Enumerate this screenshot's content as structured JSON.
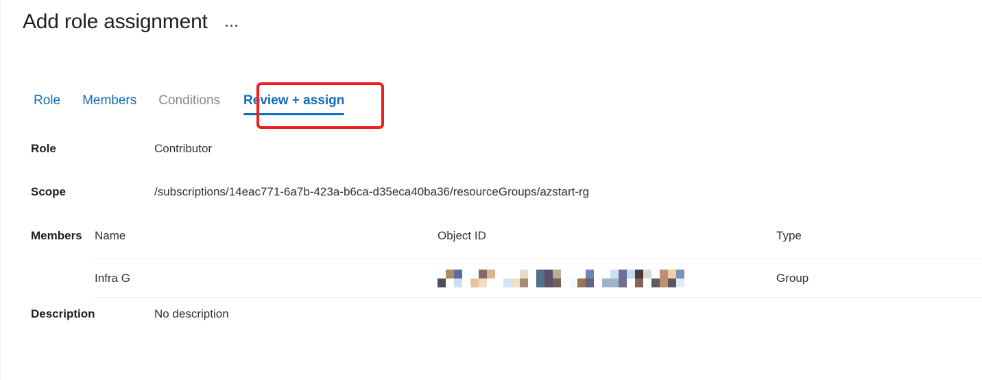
{
  "header": {
    "title": "Add role assignment",
    "more_actions_label": "More actions",
    "more_actions_icon": "ellipsis-icon"
  },
  "tabs": [
    {
      "label": "Role",
      "state": "link"
    },
    {
      "label": "Members",
      "state": "link"
    },
    {
      "label": "Conditions",
      "state": "disabled"
    },
    {
      "label": "Review + assign",
      "state": "active"
    }
  ],
  "highlight": {
    "target_tab": "Review + assign",
    "color": "#f01b1b"
  },
  "details": {
    "role": {
      "label": "Role",
      "value": "Contributor"
    },
    "scope": {
      "label": "Scope",
      "value": "/subscriptions/14eac771-6a7b-423a-b6ca-d35eca40ba36/resourceGroups/azstart-rg"
    },
    "members": {
      "label": "Members",
      "columns": [
        "Name",
        "Object ID",
        "Type"
      ],
      "rows": [
        {
          "name": "Infra G",
          "object_id": "",
          "object_id_redacted": true,
          "type": "Group"
        }
      ]
    },
    "description": {
      "label": "Description",
      "value": "No description"
    }
  },
  "colors": {
    "accent": "#0f6cbd",
    "text": "#201f1e",
    "muted_text": "#8a8886",
    "divider": "#ededed",
    "highlight": "#f01b1b",
    "background": "#ffffff"
  },
  "redaction": {
    "chunks": [
      [
        [
          "#ffffff",
          "#4f4f52"
        ],
        [
          "#b08a63",
          "#ffffff"
        ],
        [
          "#5a6e9c",
          "#cddcf0"
        ]
      ],
      [
        [
          "#ffffff",
          "#e8c49c"
        ],
        [
          "#8a6663",
          "#efdcc4"
        ],
        [
          "#d7b695",
          "#ffffff"
        ]
      ],
      [
        [
          "#ffffff",
          "#cfe4f6"
        ],
        [
          "#ffffff",
          "#eedfc6"
        ],
        [
          "#e9dcc8",
          "#a08d72"
        ]
      ],
      [
        [
          "#51708a",
          "#51708a"
        ],
        [
          "#5d4f6b",
          "#5d4f6b"
        ],
        [
          "#bcab97",
          "#6d6258"
        ]
      ],
      [
        [
          "#ffffff",
          "#f2fbfb"
        ],
        [
          "#ffffff",
          "#9b7550"
        ],
        [
          "#6d84b5",
          "#5b6480"
        ]
      ],
      [
        [
          "#ffffff",
          "#9fb4cc"
        ],
        [
          "#cfe0ef",
          "#9fb4cc"
        ],
        [
          "#6f6f93",
          "#6f6f93"
        ],
        [
          "#bedcf4",
          "#ffffff"
        ],
        [
          "#463c38",
          "#8a625c"
        ],
        [
          "#d9d9d6",
          "#ffffff"
        ],
        [
          "#ffffff",
          "#5d5d5d"
        ],
        [
          "#c08e74",
          "#c08e74"
        ],
        [
          "#f0cfa0",
          "#5a5a5a"
        ],
        [
          "#7493bd",
          "#dfeaf5"
        ]
      ]
    ]
  }
}
